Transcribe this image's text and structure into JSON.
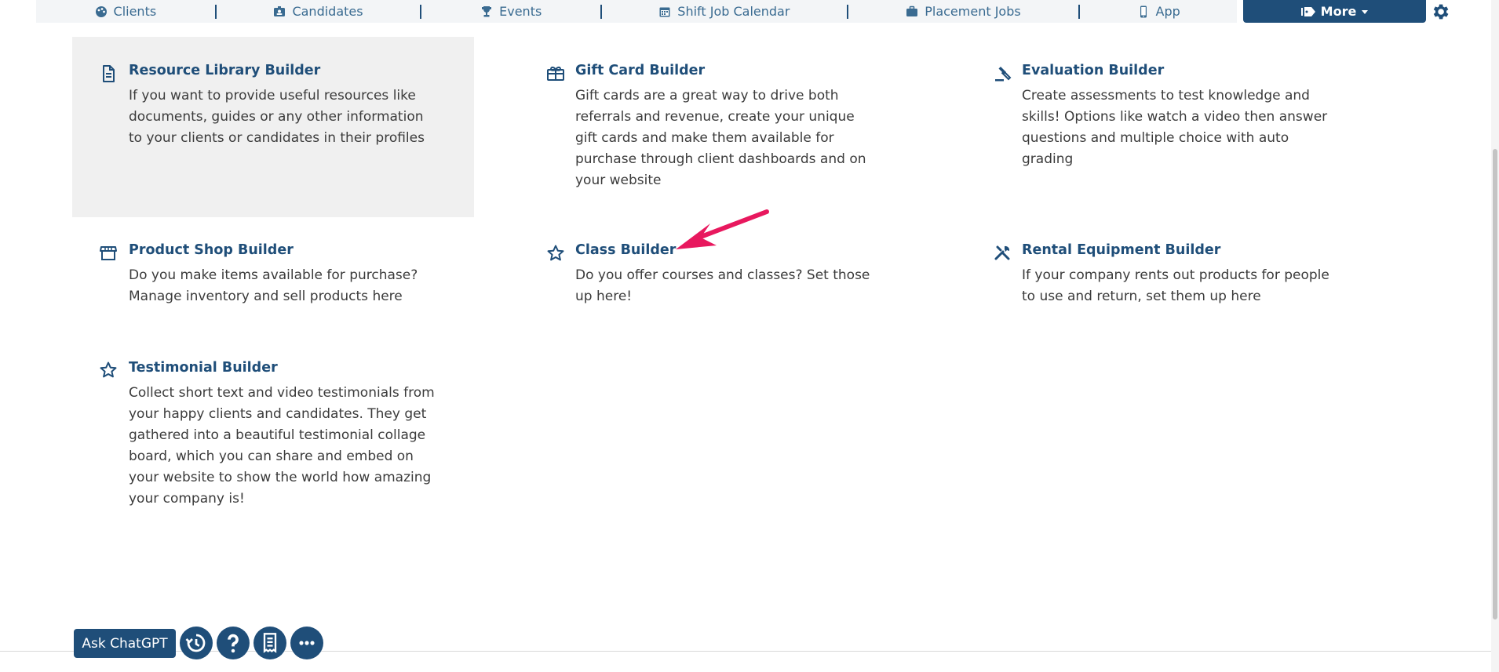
{
  "nav": {
    "items": [
      {
        "label": "Clients",
        "icon": "palette-icon"
      },
      {
        "label": "Candidates",
        "icon": "id-card-icon"
      },
      {
        "label": "Events",
        "icon": "trophy-icon"
      },
      {
        "label": "Shift Job Calendar",
        "icon": "calendar-icon"
      },
      {
        "label": "Placement Jobs",
        "icon": "briefcase-icon"
      },
      {
        "label": "App",
        "icon": "mobile-icon"
      }
    ],
    "more_label": "More",
    "accent": "#1f4e79"
  },
  "cards": [
    {
      "title": "Resource Library Builder",
      "description": "If you want to provide useful resources like documents, guides or any other information to your clients or candidates in their profiles",
      "icon": "document-icon"
    },
    {
      "title": "Gift Card Builder",
      "description": "Gift cards are a great way to drive both referrals and revenue, create your unique gift cards and make them available for purchase through client dashboards and on your website",
      "icon": "gift-icon"
    },
    {
      "title": "Evaluation Builder",
      "description": "Create assessments to test knowledge and skills! Options like watch a video then answer questions and multiple choice with auto grading",
      "icon": "gavel-icon"
    },
    {
      "title": "Product Shop Builder",
      "description": "Do you make items available for purchase? Manage inventory and sell products here",
      "icon": "store-icon"
    },
    {
      "title": "Class Builder",
      "description": "Do you offer courses and classes? Set those up here!",
      "icon": "star-outline-icon"
    },
    {
      "title": "Rental Equipment Builder",
      "description": "If your company rents out products for people to use and return, set them up here",
      "icon": "tools-icon"
    },
    {
      "title": "Testimonial Builder",
      "description": "Collect short text and video testimonials from your happy clients and candidates. They get gathered into a beautiful testimonial collage board, which you can share and embed on your website to show the world how amazing your company is!",
      "icon": "star-outline-icon"
    }
  ],
  "bottom": {
    "ask_label": "Ask ChatGPT",
    "buttons": [
      "history-icon",
      "help-icon",
      "receipt-icon",
      "more-dots-icon"
    ]
  },
  "annotation_color": "#e8185e"
}
